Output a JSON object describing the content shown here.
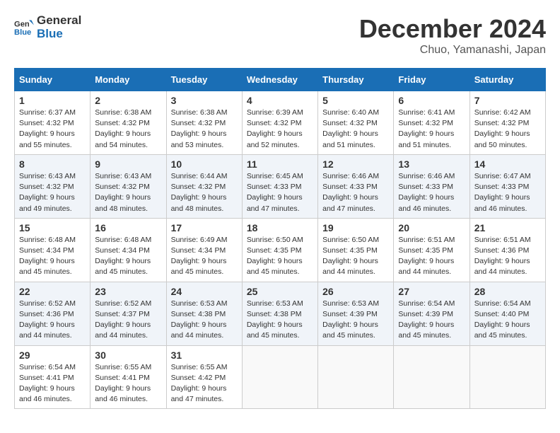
{
  "header": {
    "logo_line1": "General",
    "logo_line2": "Blue",
    "month_year": "December 2024",
    "location": "Chuo, Yamanashi, Japan"
  },
  "weekdays": [
    "Sunday",
    "Monday",
    "Tuesday",
    "Wednesday",
    "Thursday",
    "Friday",
    "Saturday"
  ],
  "weeks": [
    [
      {
        "day": "1",
        "sunrise": "6:37 AM",
        "sunset": "4:32 PM",
        "daylight": "9 hours and 55 minutes."
      },
      {
        "day": "2",
        "sunrise": "6:38 AM",
        "sunset": "4:32 PM",
        "daylight": "9 hours and 54 minutes."
      },
      {
        "day": "3",
        "sunrise": "6:38 AM",
        "sunset": "4:32 PM",
        "daylight": "9 hours and 53 minutes."
      },
      {
        "day": "4",
        "sunrise": "6:39 AM",
        "sunset": "4:32 PM",
        "daylight": "9 hours and 52 minutes."
      },
      {
        "day": "5",
        "sunrise": "6:40 AM",
        "sunset": "4:32 PM",
        "daylight": "9 hours and 51 minutes."
      },
      {
        "day": "6",
        "sunrise": "6:41 AM",
        "sunset": "4:32 PM",
        "daylight": "9 hours and 51 minutes."
      },
      {
        "day": "7",
        "sunrise": "6:42 AM",
        "sunset": "4:32 PM",
        "daylight": "9 hours and 50 minutes."
      }
    ],
    [
      {
        "day": "8",
        "sunrise": "6:43 AM",
        "sunset": "4:32 PM",
        "daylight": "9 hours and 49 minutes."
      },
      {
        "day": "9",
        "sunrise": "6:43 AM",
        "sunset": "4:32 PM",
        "daylight": "9 hours and 48 minutes."
      },
      {
        "day": "10",
        "sunrise": "6:44 AM",
        "sunset": "4:32 PM",
        "daylight": "9 hours and 48 minutes."
      },
      {
        "day": "11",
        "sunrise": "6:45 AM",
        "sunset": "4:33 PM",
        "daylight": "9 hours and 47 minutes."
      },
      {
        "day": "12",
        "sunrise": "6:46 AM",
        "sunset": "4:33 PM",
        "daylight": "9 hours and 47 minutes."
      },
      {
        "day": "13",
        "sunrise": "6:46 AM",
        "sunset": "4:33 PM",
        "daylight": "9 hours and 46 minutes."
      },
      {
        "day": "14",
        "sunrise": "6:47 AM",
        "sunset": "4:33 PM",
        "daylight": "9 hours and 46 minutes."
      }
    ],
    [
      {
        "day": "15",
        "sunrise": "6:48 AM",
        "sunset": "4:34 PM",
        "daylight": "9 hours and 45 minutes."
      },
      {
        "day": "16",
        "sunrise": "6:48 AM",
        "sunset": "4:34 PM",
        "daylight": "9 hours and 45 minutes."
      },
      {
        "day": "17",
        "sunrise": "6:49 AM",
        "sunset": "4:34 PM",
        "daylight": "9 hours and 45 minutes."
      },
      {
        "day": "18",
        "sunrise": "6:50 AM",
        "sunset": "4:35 PM",
        "daylight": "9 hours and 45 minutes."
      },
      {
        "day": "19",
        "sunrise": "6:50 AM",
        "sunset": "4:35 PM",
        "daylight": "9 hours and 44 minutes."
      },
      {
        "day": "20",
        "sunrise": "6:51 AM",
        "sunset": "4:35 PM",
        "daylight": "9 hours and 44 minutes."
      },
      {
        "day": "21",
        "sunrise": "6:51 AM",
        "sunset": "4:36 PM",
        "daylight": "9 hours and 44 minutes."
      }
    ],
    [
      {
        "day": "22",
        "sunrise": "6:52 AM",
        "sunset": "4:36 PM",
        "daylight": "9 hours and 44 minutes."
      },
      {
        "day": "23",
        "sunrise": "6:52 AM",
        "sunset": "4:37 PM",
        "daylight": "9 hours and 44 minutes."
      },
      {
        "day": "24",
        "sunrise": "6:53 AM",
        "sunset": "4:38 PM",
        "daylight": "9 hours and 44 minutes."
      },
      {
        "day": "25",
        "sunrise": "6:53 AM",
        "sunset": "4:38 PM",
        "daylight": "9 hours and 45 minutes."
      },
      {
        "day": "26",
        "sunrise": "6:53 AM",
        "sunset": "4:39 PM",
        "daylight": "9 hours and 45 minutes."
      },
      {
        "day": "27",
        "sunrise": "6:54 AM",
        "sunset": "4:39 PM",
        "daylight": "9 hours and 45 minutes."
      },
      {
        "day": "28",
        "sunrise": "6:54 AM",
        "sunset": "4:40 PM",
        "daylight": "9 hours and 45 minutes."
      }
    ],
    [
      {
        "day": "29",
        "sunrise": "6:54 AM",
        "sunset": "4:41 PM",
        "daylight": "9 hours and 46 minutes."
      },
      {
        "day": "30",
        "sunrise": "6:55 AM",
        "sunset": "4:41 PM",
        "daylight": "9 hours and 46 minutes."
      },
      {
        "day": "31",
        "sunrise": "6:55 AM",
        "sunset": "4:42 PM",
        "daylight": "9 hours and 47 minutes."
      },
      null,
      null,
      null,
      null
    ]
  ]
}
